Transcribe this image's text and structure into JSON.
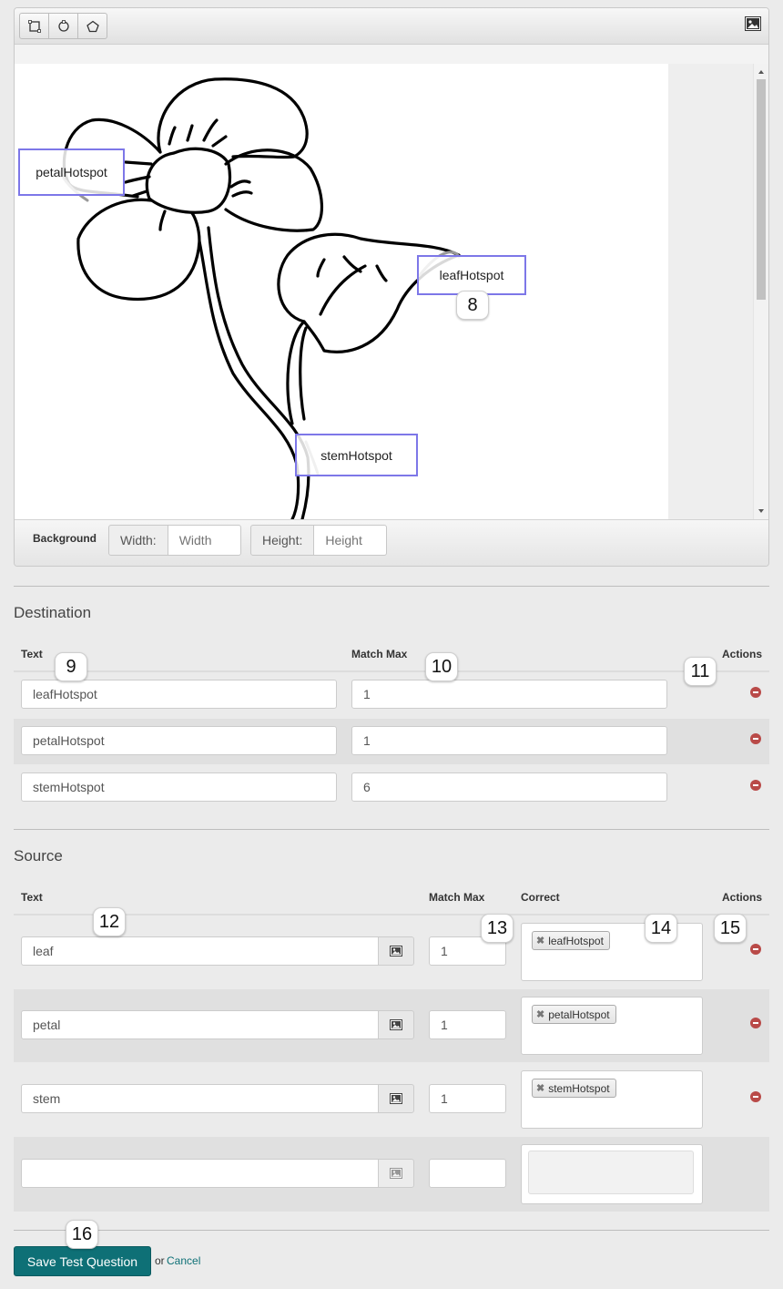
{
  "editor": {
    "tools": [
      {
        "name": "rectangle-icon"
      },
      {
        "name": "circle-icon"
      },
      {
        "name": "polygon-icon"
      }
    ],
    "image_toggle_icon": "image-icon",
    "hotspots": [
      {
        "label": "petalHotspot"
      },
      {
        "label": "leafHotspot"
      },
      {
        "label": "stemHotspot"
      }
    ],
    "background_label": "Background",
    "width_label": "Width:",
    "width_placeholder": "Width",
    "height_label": "Height:",
    "height_placeholder": "Height"
  },
  "destination": {
    "title": "Destination",
    "col_text": "Text",
    "col_match_max": "Match Max",
    "col_actions": "Actions",
    "rows": [
      {
        "text": "leafHotspot",
        "match_max": "1"
      },
      {
        "text": "petalHotspot",
        "match_max": "1"
      },
      {
        "text": "stemHotspot",
        "match_max": "6"
      }
    ]
  },
  "source": {
    "title": "Source",
    "col_text": "Text",
    "col_match_max": "Match Max",
    "col_correct": "Correct",
    "col_actions": "Actions",
    "rows": [
      {
        "text": "leaf",
        "match_max": "1",
        "correct": "leafHotspot"
      },
      {
        "text": "petal",
        "match_max": "1",
        "correct": "petalHotspot"
      },
      {
        "text": "stem",
        "match_max": "1",
        "correct": "stemHotspot"
      },
      {
        "text": "",
        "match_max": "",
        "correct": ""
      }
    ]
  },
  "callouts": [
    "8",
    "9",
    "10",
    "11",
    "12",
    "13",
    "14",
    "15",
    "16"
  ],
  "actions": {
    "save_label": "Save Test Question",
    "or_text": "or",
    "cancel_label": "Cancel"
  }
}
